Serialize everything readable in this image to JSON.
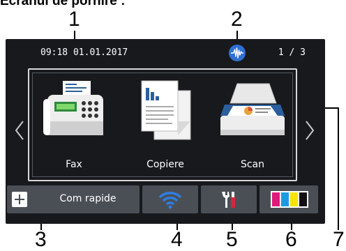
{
  "heading": "Ecranul de pornire :",
  "callouts": [
    "1",
    "2",
    "3",
    "4",
    "5",
    "6",
    "7"
  ],
  "status_bar": {
    "datetime": "09:18  01.01.2017",
    "page_indicator": "1 / 3",
    "signal_icon": "network-signal-icon"
  },
  "apps": [
    {
      "label": "Fax",
      "icon": "fax-machine-icon"
    },
    {
      "label": "Copiere",
      "icon": "copy-documents-icon"
    },
    {
      "label": "Scan",
      "icon": "flatbed-scanner-icon"
    }
  ],
  "bottom_bar": {
    "shortcuts_label": "Com rapide",
    "shortcuts_icon": "plus-icon",
    "wifi_icon": "wifi-icon",
    "settings_icon": "settings-tools-icon",
    "toner_icon": "toner-cartridges-icon"
  },
  "colors": {
    "screen_bg": "#17191d",
    "button_bg": "#4a4f56",
    "signal_blue": "#2f6fd6",
    "wifi_blue": "#2f7de1",
    "toner": [
      "#e0197d",
      "#1e9be0",
      "#f5e400",
      "#111111"
    ]
  }
}
